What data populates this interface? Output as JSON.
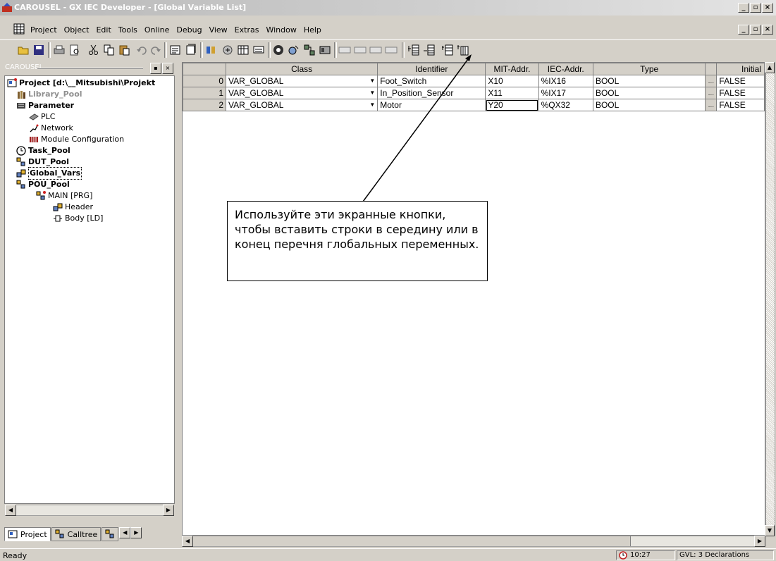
{
  "window": {
    "title": "CAROUSEL - GX IEC Developer - [Global Variable List]",
    "minimize": "_",
    "maximize": "▫",
    "close": "×"
  },
  "menu": {
    "items": [
      "Project",
      "Object",
      "Edit",
      "Tools",
      "Online",
      "Debug",
      "View",
      "Extras",
      "Window",
      "Help"
    ]
  },
  "left_pane": {
    "header": "CAROUSEL",
    "tree": [
      {
        "label": "Project [d:\\__Mitsubishi\\Projekt",
        "icon": "project-icon"
      },
      {
        "label": "Library_Pool",
        "icon": "library-icon"
      },
      {
        "label": "Parameter",
        "icon": "parameter-icon"
      },
      {
        "label": "PLC",
        "icon": "plc-icon"
      },
      {
        "label": "Network",
        "icon": "network-icon"
      },
      {
        "label": "Module Configuration",
        "icon": "module-icon"
      },
      {
        "label": "Task_Pool",
        "icon": "task-icon"
      },
      {
        "label": "DUT_Pool",
        "icon": "dut-icon"
      },
      {
        "label": "Global_Vars",
        "icon": "global-vars-icon"
      },
      {
        "label": "POU_Pool",
        "icon": "pou-pool-icon"
      },
      {
        "label": "MAIN [PRG]",
        "icon": "pou-icon"
      },
      {
        "label": "Header",
        "icon": "header-icon"
      },
      {
        "label": "Body [LD]",
        "icon": "ld-body-icon"
      }
    ],
    "tabs": [
      "Project",
      "Calltree",
      ""
    ]
  },
  "grid": {
    "columns": [
      "",
      "Class",
      "Identifier",
      "MIT-Addr.",
      "IEC-Addr.",
      "Type",
      "",
      "Initial"
    ],
    "rows": [
      {
        "num": "0",
        "class": "VAR_GLOBAL",
        "identifier": "Foot_Switch",
        "mit": "X10",
        "iec": "%IX16",
        "type": "BOOL",
        "initial": "FALSE"
      },
      {
        "num": "1",
        "class": "VAR_GLOBAL",
        "identifier": "In_Position_Sensor",
        "mit": "X11",
        "iec": "%IX17",
        "type": "BOOL",
        "initial": "FALSE"
      },
      {
        "num": "2",
        "class": "VAR_GLOBAL",
        "identifier": "Motor",
        "mit": "Y20",
        "iec": "%QX32",
        "type": "BOOL",
        "initial": "FALSE"
      }
    ]
  },
  "callout": {
    "text": "Используйте эти экранные кнопки, чтобы вставить строки в середину или в конец перечня глобальных переменных."
  },
  "status": {
    "ready": "Ready",
    "time": "10:27",
    "info": "GVL: 3 Declarations"
  }
}
